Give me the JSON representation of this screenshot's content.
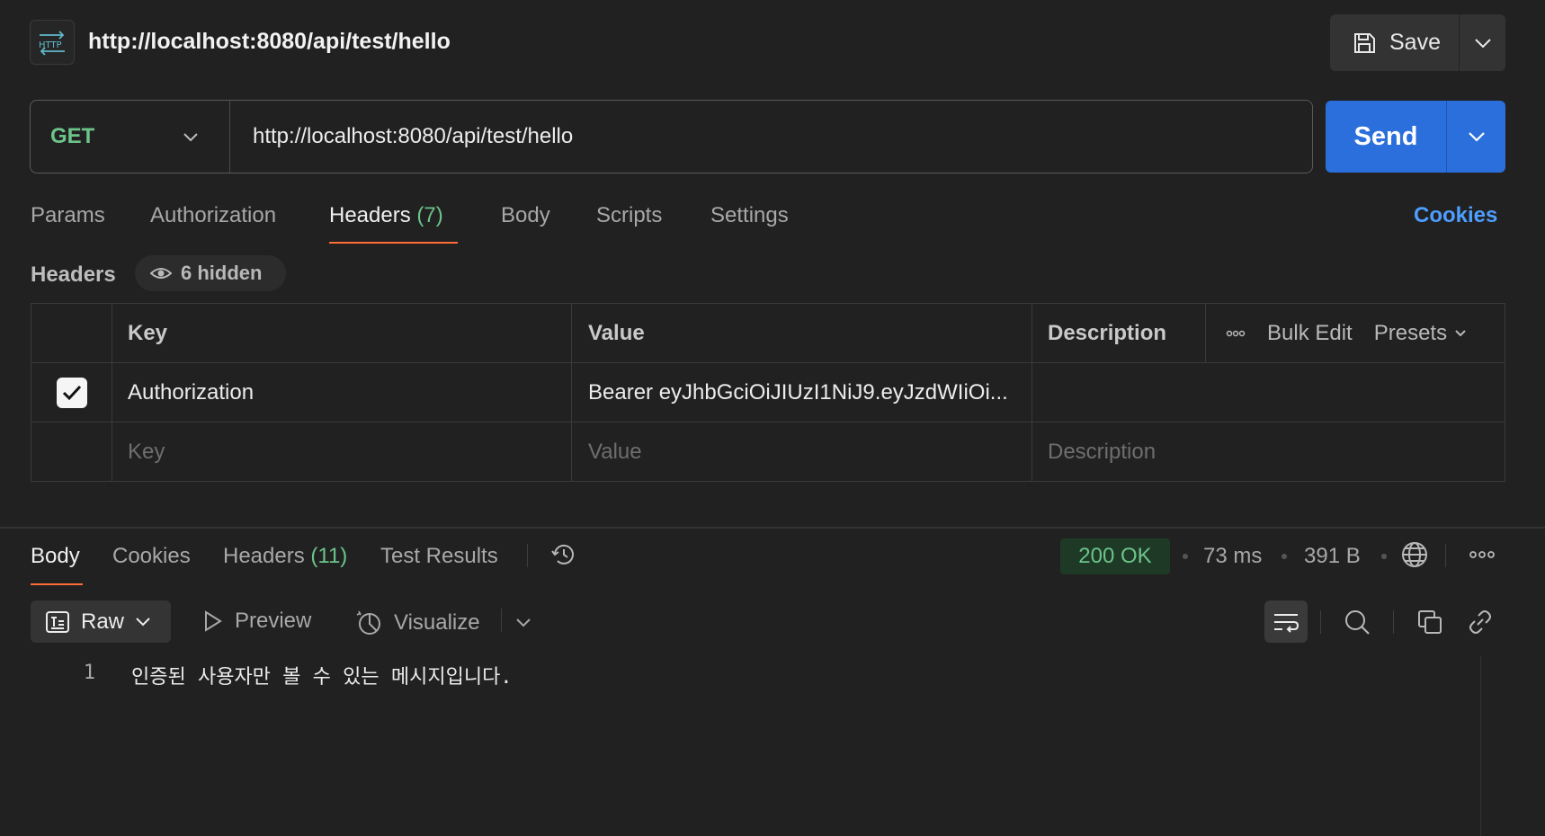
{
  "request": {
    "title": "http://localhost:8080/api/test/hello",
    "method": "GET",
    "url": "http://localhost:8080/api/test/hello",
    "save_label": "Save",
    "send_label": "Send"
  },
  "request_tabs": [
    {
      "label": "Params"
    },
    {
      "label": "Authorization"
    },
    {
      "label": "Headers",
      "count": "(7)",
      "active": true
    },
    {
      "label": "Body"
    },
    {
      "label": "Scripts"
    },
    {
      "label": "Settings"
    }
  ],
  "cookies_link": "Cookies",
  "headers_section": {
    "title": "Headers",
    "hidden_label": "6 hidden",
    "columns": {
      "key": "Key",
      "value": "Value",
      "description": "Description"
    },
    "actions": {
      "bulk_edit": "Bulk Edit",
      "presets": "Presets"
    },
    "rows": [
      {
        "checked": true,
        "key": "Authorization",
        "value": "Bearer eyJhbGciOiJIUzI1NiJ9.eyJzdWIiOi...",
        "description": ""
      }
    ],
    "placeholders": {
      "key": "Key",
      "value": "Value",
      "description": "Description"
    }
  },
  "response": {
    "tabs": [
      {
        "label": "Body",
        "active": true
      },
      {
        "label": "Cookies"
      },
      {
        "label": "Headers",
        "count": "(11)"
      },
      {
        "label": "Test Results"
      }
    ],
    "status": "200 OK",
    "time": "73 ms",
    "size": "391 B",
    "format": "Raw",
    "preview_label": "Preview",
    "visualize_label": "Visualize",
    "lines": [
      {
        "number": "1",
        "text": "인증된 사용자만 볼 수 있는 메시지입니다."
      }
    ]
  },
  "colors": {
    "accent_orange": "#ff6c37",
    "send_blue": "#2a6fdb",
    "method_green": "#6cc48a",
    "link_blue": "#4d9eff"
  },
  "icons": [
    "http-icon",
    "save-icon",
    "chevron-down-icon",
    "eye-icon",
    "check-icon",
    "more-icon",
    "history-icon",
    "globe-icon",
    "raw-text-icon",
    "play-icon",
    "visualize-icon",
    "wrap-lines-icon",
    "search-icon",
    "copy-icon",
    "link-icon"
  ]
}
